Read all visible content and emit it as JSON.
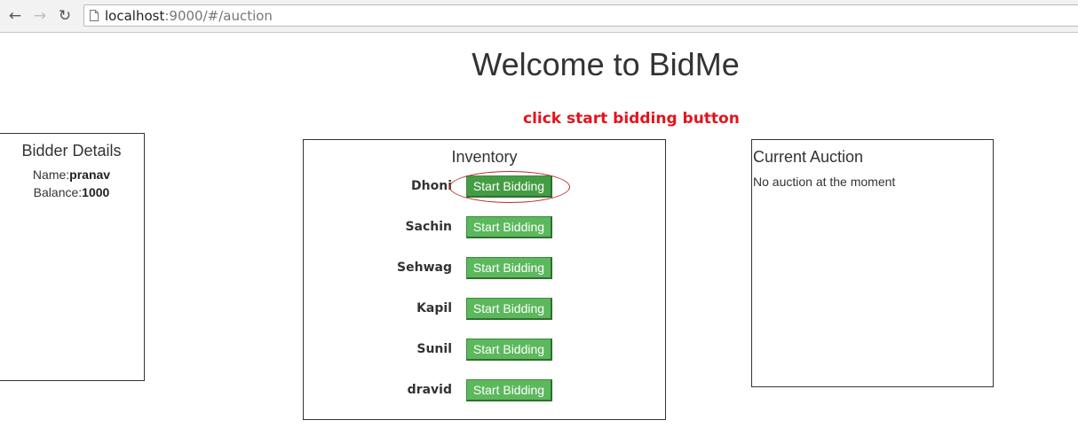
{
  "browser": {
    "url_host": "localhost",
    "url_rest": ":9000/#/auction"
  },
  "page": {
    "title": "Welcome to BidMe",
    "annotation": "click start bidding button"
  },
  "bidder": {
    "title": "Bidder Details",
    "name_label": "Name:",
    "name_value": "pranav",
    "balance_label": "Balance:",
    "balance_value": "1000"
  },
  "inventory": {
    "title": "Inventory",
    "button_label": "Start Bidding",
    "items": [
      {
        "name": "Dhoni"
      },
      {
        "name": "Sachin"
      },
      {
        "name": "Sehwag"
      },
      {
        "name": "Kapil"
      },
      {
        "name": "Sunil"
      },
      {
        "name": "dravid"
      }
    ]
  },
  "auction": {
    "title": "Current Auction",
    "status": "No auction at the moment"
  },
  "colors": {
    "button_green": "#5cb85c",
    "annotation_red": "#e3141d"
  }
}
